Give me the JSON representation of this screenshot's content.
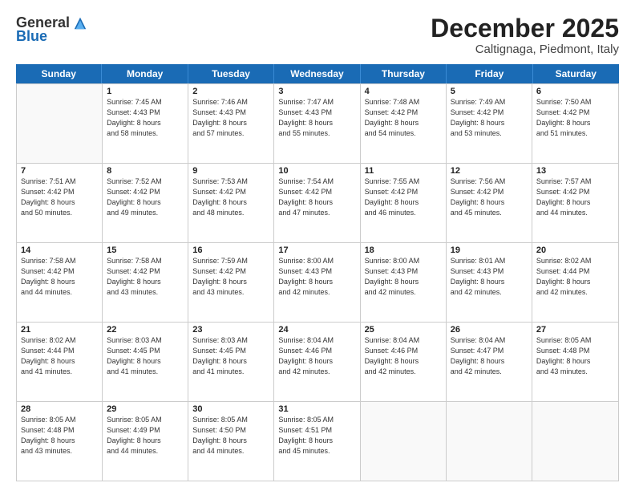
{
  "logo": {
    "general": "General",
    "blue": "Blue"
  },
  "title": "December 2025",
  "subtitle": "Caltignaga, Piedmont, Italy",
  "header_days": [
    "Sunday",
    "Monday",
    "Tuesday",
    "Wednesday",
    "Thursday",
    "Friday",
    "Saturday"
  ],
  "rows": [
    [
      {
        "day": "",
        "info": ""
      },
      {
        "day": "1",
        "info": "Sunrise: 7:45 AM\nSunset: 4:43 PM\nDaylight: 8 hours\nand 58 minutes."
      },
      {
        "day": "2",
        "info": "Sunrise: 7:46 AM\nSunset: 4:43 PM\nDaylight: 8 hours\nand 57 minutes."
      },
      {
        "day": "3",
        "info": "Sunrise: 7:47 AM\nSunset: 4:43 PM\nDaylight: 8 hours\nand 55 minutes."
      },
      {
        "day": "4",
        "info": "Sunrise: 7:48 AM\nSunset: 4:42 PM\nDaylight: 8 hours\nand 54 minutes."
      },
      {
        "day": "5",
        "info": "Sunrise: 7:49 AM\nSunset: 4:42 PM\nDaylight: 8 hours\nand 53 minutes."
      },
      {
        "day": "6",
        "info": "Sunrise: 7:50 AM\nSunset: 4:42 PM\nDaylight: 8 hours\nand 51 minutes."
      }
    ],
    [
      {
        "day": "7",
        "info": "Sunrise: 7:51 AM\nSunset: 4:42 PM\nDaylight: 8 hours\nand 50 minutes."
      },
      {
        "day": "8",
        "info": "Sunrise: 7:52 AM\nSunset: 4:42 PM\nDaylight: 8 hours\nand 49 minutes."
      },
      {
        "day": "9",
        "info": "Sunrise: 7:53 AM\nSunset: 4:42 PM\nDaylight: 8 hours\nand 48 minutes."
      },
      {
        "day": "10",
        "info": "Sunrise: 7:54 AM\nSunset: 4:42 PM\nDaylight: 8 hours\nand 47 minutes."
      },
      {
        "day": "11",
        "info": "Sunrise: 7:55 AM\nSunset: 4:42 PM\nDaylight: 8 hours\nand 46 minutes."
      },
      {
        "day": "12",
        "info": "Sunrise: 7:56 AM\nSunset: 4:42 PM\nDaylight: 8 hours\nand 45 minutes."
      },
      {
        "day": "13",
        "info": "Sunrise: 7:57 AM\nSunset: 4:42 PM\nDaylight: 8 hours\nand 44 minutes."
      }
    ],
    [
      {
        "day": "14",
        "info": "Sunrise: 7:58 AM\nSunset: 4:42 PM\nDaylight: 8 hours\nand 44 minutes."
      },
      {
        "day": "15",
        "info": "Sunrise: 7:58 AM\nSunset: 4:42 PM\nDaylight: 8 hours\nand 43 minutes."
      },
      {
        "day": "16",
        "info": "Sunrise: 7:59 AM\nSunset: 4:42 PM\nDaylight: 8 hours\nand 43 minutes."
      },
      {
        "day": "17",
        "info": "Sunrise: 8:00 AM\nSunset: 4:43 PM\nDaylight: 8 hours\nand 42 minutes."
      },
      {
        "day": "18",
        "info": "Sunrise: 8:00 AM\nSunset: 4:43 PM\nDaylight: 8 hours\nand 42 minutes."
      },
      {
        "day": "19",
        "info": "Sunrise: 8:01 AM\nSunset: 4:43 PM\nDaylight: 8 hours\nand 42 minutes."
      },
      {
        "day": "20",
        "info": "Sunrise: 8:02 AM\nSunset: 4:44 PM\nDaylight: 8 hours\nand 42 minutes."
      }
    ],
    [
      {
        "day": "21",
        "info": "Sunrise: 8:02 AM\nSunset: 4:44 PM\nDaylight: 8 hours\nand 41 minutes."
      },
      {
        "day": "22",
        "info": "Sunrise: 8:03 AM\nSunset: 4:45 PM\nDaylight: 8 hours\nand 41 minutes."
      },
      {
        "day": "23",
        "info": "Sunrise: 8:03 AM\nSunset: 4:45 PM\nDaylight: 8 hours\nand 41 minutes."
      },
      {
        "day": "24",
        "info": "Sunrise: 8:04 AM\nSunset: 4:46 PM\nDaylight: 8 hours\nand 42 minutes."
      },
      {
        "day": "25",
        "info": "Sunrise: 8:04 AM\nSunset: 4:46 PM\nDaylight: 8 hours\nand 42 minutes."
      },
      {
        "day": "26",
        "info": "Sunrise: 8:04 AM\nSunset: 4:47 PM\nDaylight: 8 hours\nand 42 minutes."
      },
      {
        "day": "27",
        "info": "Sunrise: 8:05 AM\nSunset: 4:48 PM\nDaylight: 8 hours\nand 43 minutes."
      }
    ],
    [
      {
        "day": "28",
        "info": "Sunrise: 8:05 AM\nSunset: 4:48 PM\nDaylight: 8 hours\nand 43 minutes."
      },
      {
        "day": "29",
        "info": "Sunrise: 8:05 AM\nSunset: 4:49 PM\nDaylight: 8 hours\nand 44 minutes."
      },
      {
        "day": "30",
        "info": "Sunrise: 8:05 AM\nSunset: 4:50 PM\nDaylight: 8 hours\nand 44 minutes."
      },
      {
        "day": "31",
        "info": "Sunrise: 8:05 AM\nSunset: 4:51 PM\nDaylight: 8 hours\nand 45 minutes."
      },
      {
        "day": "",
        "info": ""
      },
      {
        "day": "",
        "info": ""
      },
      {
        "day": "",
        "info": ""
      }
    ]
  ]
}
